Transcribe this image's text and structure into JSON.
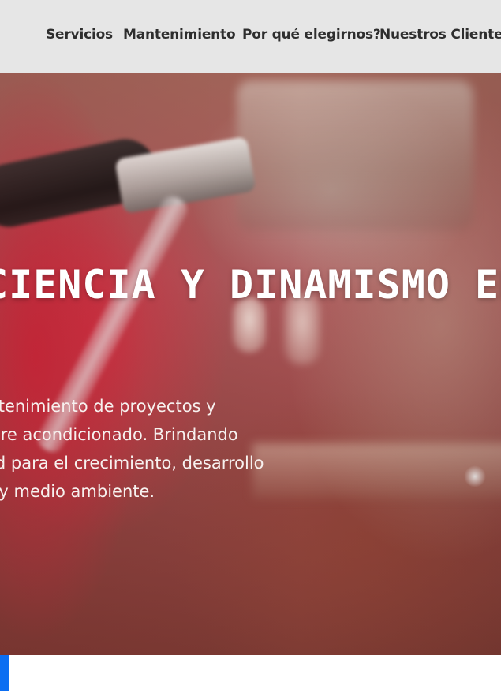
{
  "nav": {
    "items": [
      {
        "label": "Servicios"
      },
      {
        "label": "Mantenimiento"
      },
      {
        "label": "Por qué elegirnos?"
      },
      {
        "label": "Nuestros Clientes"
      }
    ]
  },
  "hero": {
    "title": "CIENCIA Y DINAMISMO EN",
    "description_lines": [
      "n y mantenimiento de proyectos y",
      "rcial y aire acondicionado. Brindando",
      "e calidad para el crecimiento, desarrollo",
      "radores y medio ambiente."
    ]
  },
  "colors": {
    "nav_background": "#e6e6e6",
    "nav_text": "#2e2e2e",
    "accent_blue": "#0b6ef2",
    "hero_text": "#ffffff"
  }
}
